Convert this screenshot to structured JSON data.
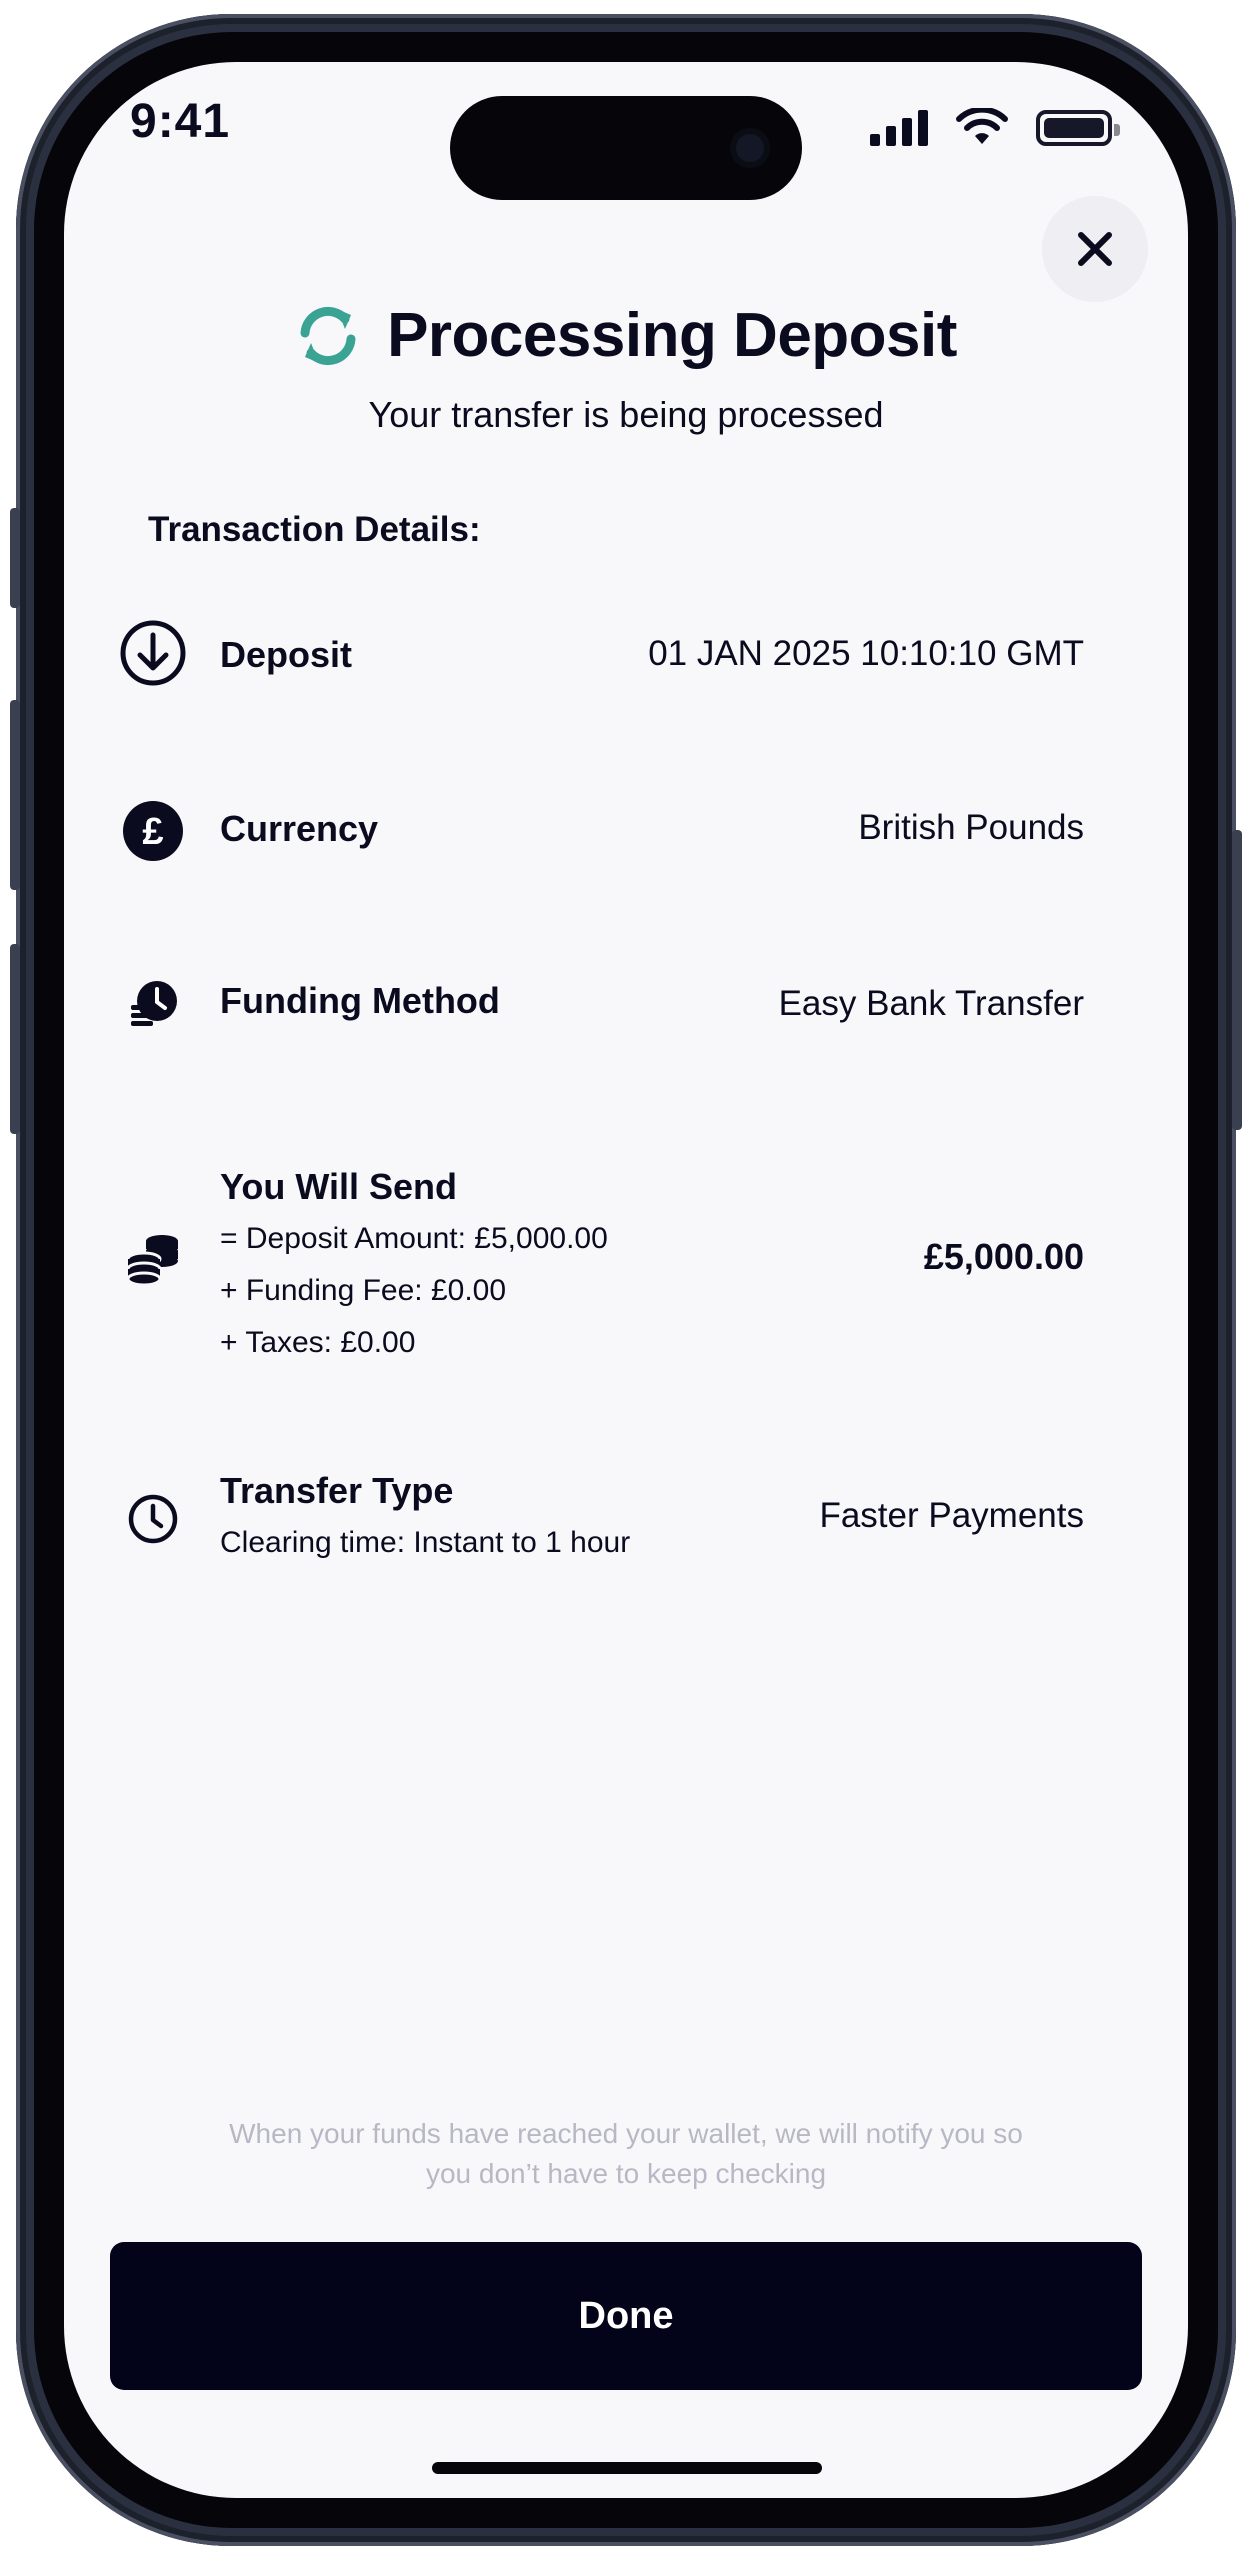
{
  "status_bar": {
    "time": "9:41",
    "icons": [
      "signal-icon",
      "wifi-icon",
      "battery-icon"
    ]
  },
  "header": {
    "title": "Processing Deposit",
    "subtitle": "Your transfer is being processed",
    "status_icon": "refresh-icon",
    "close_icon": "close-icon"
  },
  "details": {
    "label": "Transaction Details:",
    "deposit": {
      "label": "Deposit",
      "value": "01 JAN 2025 10:10:10 GMT",
      "icon": "arrow-down-circle-icon"
    },
    "currency": {
      "label": "Currency",
      "value": "British Pounds",
      "icon": "pound-icon"
    },
    "funding": {
      "label": "Funding Method",
      "value": "Easy Bank Transfer",
      "icon": "fast-money-icon"
    },
    "send": {
      "label": "You Will Send",
      "value": "£5,000.00",
      "icon": "coins-icon",
      "lines": [
        "= Deposit Amount: £5,000.00",
        "+ Funding Fee: £0.00",
        "+ Taxes: £0.00"
      ]
    },
    "transfer": {
      "label": "Transfer Type",
      "value": "Faster Payments",
      "icon": "clock-icon",
      "sub": "Clearing time: Instant to 1 hour"
    }
  },
  "notice": {
    "line1": "When your funds have reached your wallet, we will notify you so",
    "line2": "you don’t have to keep checking"
  },
  "done_button": {
    "label": "Done"
  },
  "colors": {
    "accent": "#3aa394",
    "dark": "#03031a",
    "muted": "#b8b8c4",
    "background": "#f8f8fb"
  }
}
